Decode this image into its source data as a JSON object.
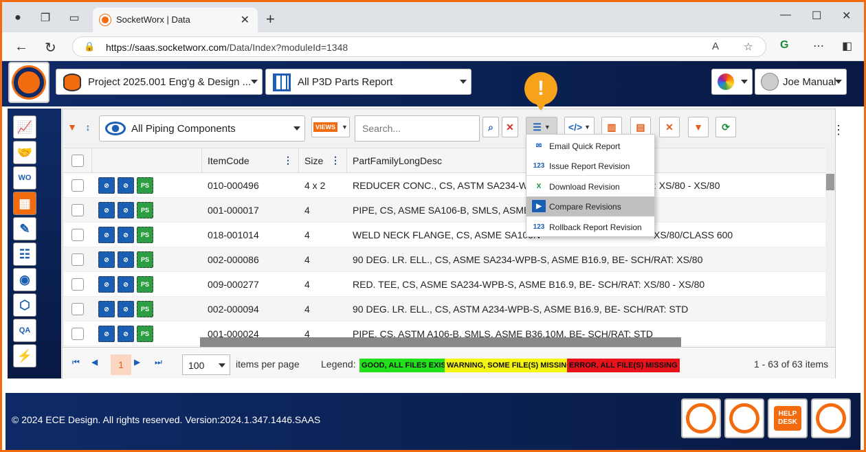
{
  "browser": {
    "tab_title": "SocketWorx | Data",
    "url_host": "https://saas.socketworx.com",
    "url_path": "/Data/Index?moduleId=1348"
  },
  "header": {
    "project": "Project 2025.001 Eng'g & Design ...",
    "report": "All P3D Parts Report",
    "user": "Joe Manual"
  },
  "toolbar": {
    "component_filter": "All Piping Components",
    "views_label": "VIEWS",
    "search_placeholder": "Search..."
  },
  "grid": {
    "columns": [
      "ItemCode",
      "Size",
      "PartFamilyLongDesc"
    ],
    "row_button_labels": [
      "PS"
    ],
    "rows": [
      {
        "item": "010-000496",
        "size": "4 x 2",
        "desc": "REDUCER CONC., CS, ASTM SA234-WPB",
        "desc_tail": ": XS/80 - XS/80"
      },
      {
        "item": "001-000017",
        "size": "4",
        "desc": "PIPE, CS, ASME SA106-B, SMLS, ASME B",
        "desc_tail": ""
      },
      {
        "item": "018-001014",
        "size": "4",
        "desc": "WELD NECK FLANGE, CS, ASME SA105N",
        "desc_tail": "XS/80/CLASS 600"
      },
      {
        "item": "002-000086",
        "size": "4",
        "desc": "90 DEG. LR. ELL., CS, ASME SA234-WPB-S, ASME B16.9, BE- SCH/RAT: XS/80",
        "desc_tail": ""
      },
      {
        "item": "009-000277",
        "size": "4",
        "desc": "RED. TEE, CS, ASME SA234-WPB-S, ASME B16.9, BE- SCH/RAT: XS/80 - XS/80",
        "desc_tail": ""
      },
      {
        "item": "002-000094",
        "size": "4",
        "desc": "90 DEG. LR. ELL., CS, ASTM A234-WPB-S, ASME B16.9, BE- SCH/RAT: STD",
        "desc_tail": ""
      },
      {
        "item": "001-000024",
        "size": "4",
        "desc": "PIPE, CS, ASTM A106-B, SMLS, ASME B36.10M, BE- SCH/RAT: STD",
        "desc_tail": ""
      }
    ]
  },
  "menu": {
    "items": [
      {
        "label": "Email Quick Report",
        "icon": "email-report-icon"
      },
      {
        "label": "Issue Report Revision",
        "icon": "revision-123-icon"
      },
      {
        "label": "Download Revision",
        "icon": "excel-download-icon"
      },
      {
        "label": "Compare Revisions",
        "icon": "compare-play-icon",
        "highlighted": true
      },
      {
        "label": "Rollback Report Revision",
        "icon": "rollback-123-icon"
      }
    ]
  },
  "pager": {
    "current_page": "1",
    "page_size": "100",
    "items_per_page": "items per page",
    "legend_label": "Legend:",
    "legend": [
      {
        "text": "GOOD, ALL FILES EXIST",
        "color": "#22e01c"
      },
      {
        "text": "WARNING, SOME FILE(S) MISSING",
        "color": "#f5f514"
      },
      {
        "text": "ERROR, ALL FILE(S) MISSING",
        "color": "#e8121b"
      }
    ],
    "summary": "1 - 63 of 63 items"
  },
  "footer": {
    "copyright": "© 2024 ECE Design. All rights reserved. Version:2024.1.347.1446.SAAS",
    "help_desk": "HELP DESK"
  },
  "colors": {
    "accent": "#f26b0f",
    "navy": "#0e2a66",
    "link": "#1a5fb4"
  }
}
